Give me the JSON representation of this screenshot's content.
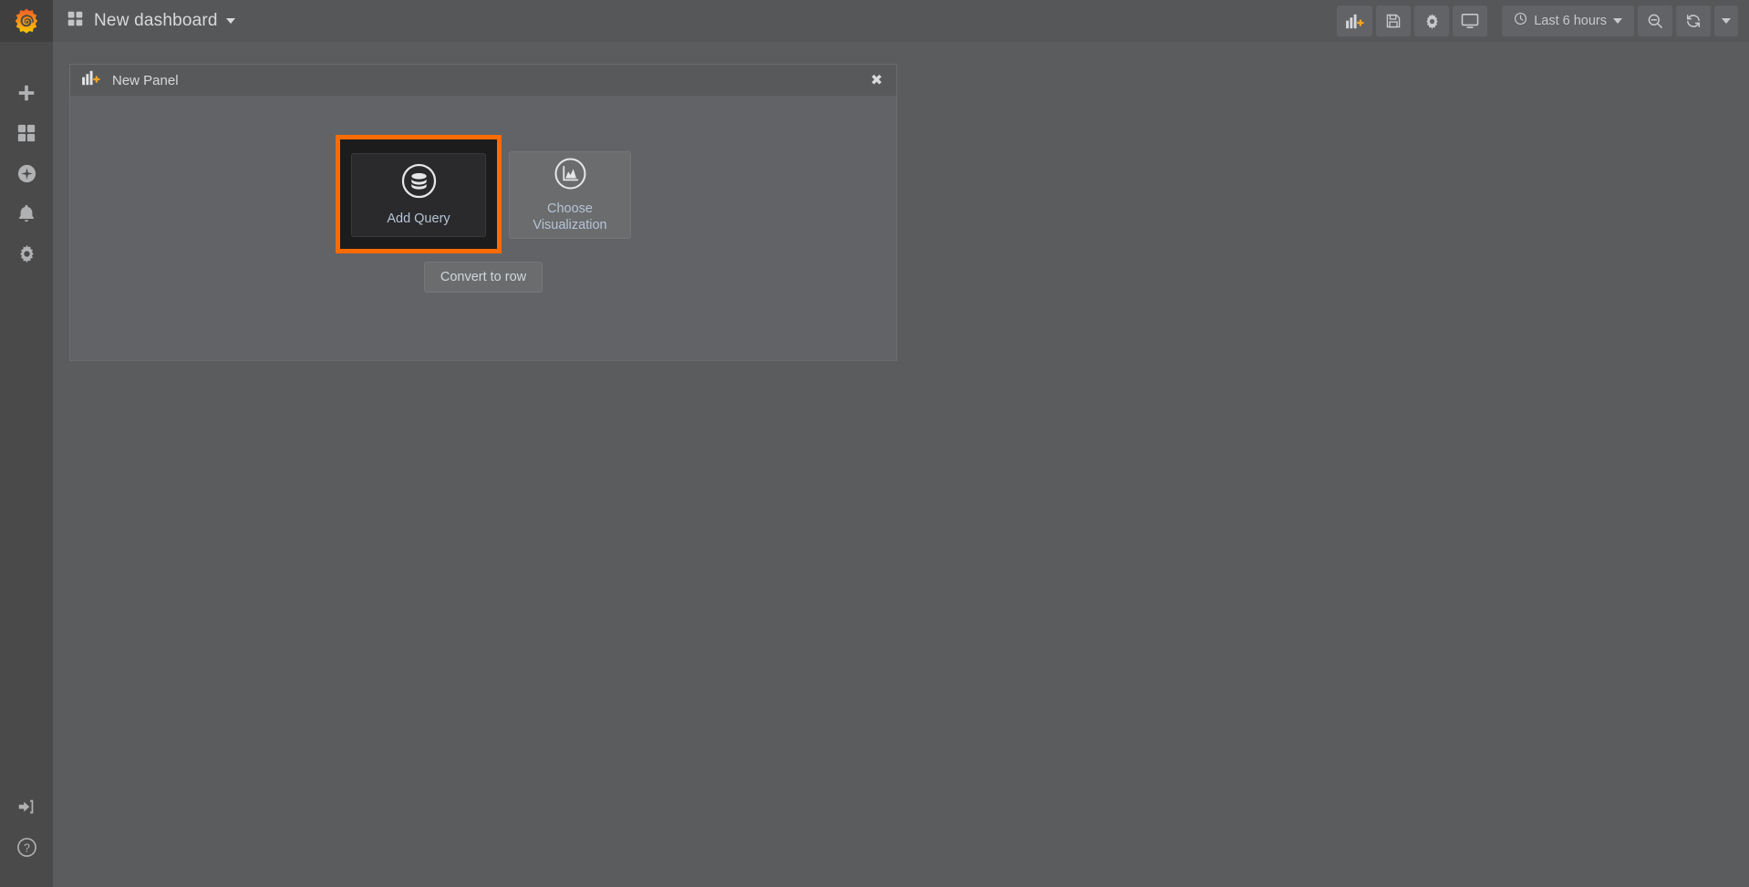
{
  "brand": {
    "logo_icon": "grafana-logo-icon",
    "accent_color": "#ff6b00",
    "logo_gradient_start": "#f05a28",
    "logo_gradient_end": "#fbca04"
  },
  "sidebar": {
    "top_items": [
      {
        "icon": "plus-icon",
        "name": "sidebar-item-create"
      },
      {
        "icon": "dashboards-icon",
        "name": "sidebar-item-dashboards"
      },
      {
        "icon": "compass-icon",
        "name": "sidebar-item-explore"
      },
      {
        "icon": "bell-icon",
        "name": "sidebar-item-alerting"
      },
      {
        "icon": "gear-icon",
        "name": "sidebar-item-configuration"
      }
    ],
    "bottom_items": [
      {
        "icon": "sign-in-icon",
        "name": "sidebar-item-sign-in"
      },
      {
        "icon": "help-circle-icon",
        "name": "sidebar-item-help"
      }
    ]
  },
  "navbar": {
    "dashboard_grid_icon": "grid-icon",
    "title": "New dashboard",
    "title_caret_icon": "chevron-down-icon",
    "buttons": [
      {
        "name": "add-panel-button",
        "icon": "bar-chart-plus-icon",
        "label": ""
      },
      {
        "name": "save-dashboard-button",
        "icon": "save-icon",
        "label": ""
      },
      {
        "name": "dashboard-settings-button",
        "icon": "gear-icon",
        "label": ""
      },
      {
        "name": "kiosk-mode-button",
        "icon": "monitor-icon",
        "label": ""
      }
    ],
    "time_picker": {
      "icon": "clock-icon",
      "label": "Last 6 hours",
      "caret_icon": "chevron-down-icon"
    },
    "zoom_out_button": {
      "name": "zoom-out-button",
      "icon": "search-minus-icon"
    },
    "refresh_button": {
      "name": "refresh-button",
      "icon": "refresh-icon"
    },
    "refresh_interval_caret": {
      "name": "refresh-interval-dropdown",
      "icon": "chevron-down-icon"
    }
  },
  "panel": {
    "header_icon": "bar-chart-plus-icon",
    "title": "New Panel",
    "close_label": "✖",
    "cards": [
      {
        "name": "add-query-card",
        "label": "Add Query",
        "icon": "database-icon",
        "selected": true
      },
      {
        "name": "choose-visualization-card",
        "label_line1": "Choose",
        "label_line2": "Visualization",
        "icon": "area-chart-icon",
        "selected": false
      }
    ],
    "convert_to_row_label": "Convert to row"
  }
}
